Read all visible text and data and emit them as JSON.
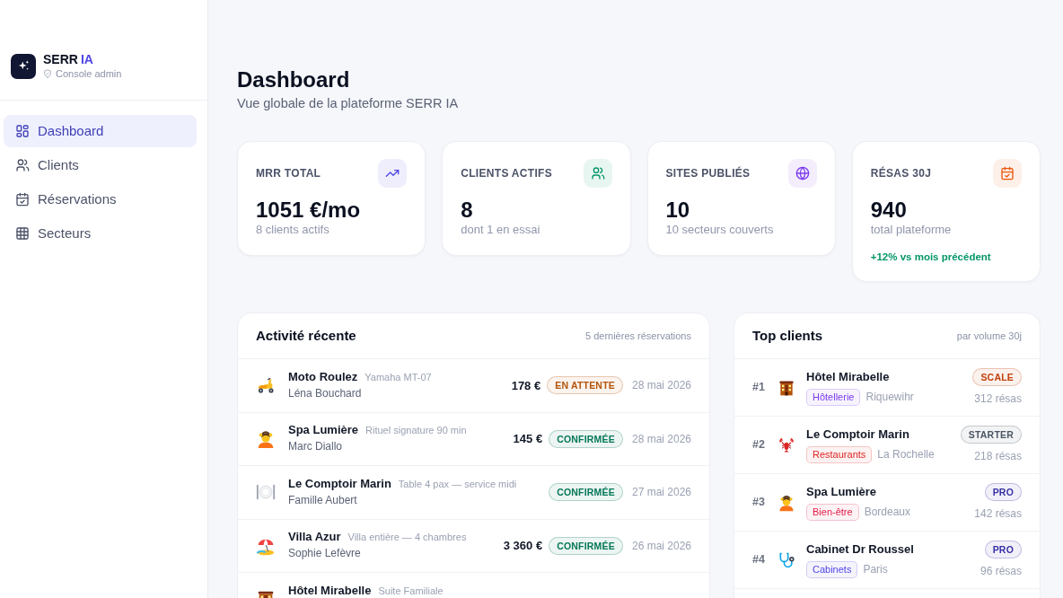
{
  "sidebar": {
    "brand": {
      "name": "SERR",
      "accent": "IA",
      "subtitle": "Console admin"
    },
    "items": [
      {
        "label": "Dashboard",
        "selected": true
      },
      {
        "label": "Clients",
        "selected": false
      },
      {
        "label": "Réservations",
        "selected": false
      },
      {
        "label": "Secteurs",
        "selected": false
      }
    ]
  },
  "header": {
    "title": "Dashboard",
    "subtitle": "Vue globale de la plateforme SERR IA"
  },
  "stats": [
    {
      "label": "MRR TOTAL",
      "value": "1051 €/mo",
      "note": "8 clients actifs",
      "color": "#4f46e5"
    },
    {
      "label": "CLIENTS ACTIFS",
      "value": "8",
      "note": "dont 1 en essai",
      "color": "#059669"
    },
    {
      "label": "SITES PUBLIÉS",
      "value": "10",
      "note": "10 secteurs couverts",
      "color": "#7c3aed"
    },
    {
      "label": "RÉSAS 30J",
      "value": "940",
      "note": "total plateforme",
      "trend": "+12% vs mois précédent",
      "color": "#ea580c"
    }
  ],
  "activity": {
    "title": "Activité récente",
    "caption": "5 dernières réservations",
    "rows": [
      {
        "business": "Moto Roulez",
        "detail": "Yamaha MT-07",
        "customer": "Léna Bouchard",
        "amount": "178 €",
        "status": {
          "label": "EN ATTENTE",
          "color": "#b45309"
        },
        "date": "28 mai 2026"
      },
      {
        "business": "Spa Lumière",
        "detail": "Rituel signature 90 min",
        "customer": "Marc Diallo",
        "amount": "145 €",
        "status": {
          "label": "CONFIRMÉE",
          "color": "#047857"
        },
        "date": "28 mai 2026"
      },
      {
        "business": "Le Comptoir Marin",
        "detail": "Table 4 pax — service midi",
        "customer": "Famille Aubert",
        "status": {
          "label": "CONFIRMÉE",
          "color": "#047857"
        },
        "date": "27 mai 2026"
      },
      {
        "business": "Villa Azur",
        "detail": "Villa entière — 4 chambres",
        "customer": "Sophie Lefèvre",
        "amount": "3 360 €",
        "status": {
          "label": "CONFIRMÉE",
          "color": "#047857"
        },
        "date": "26 mai 2026"
      },
      {
        "business": "Hôtel Mirabelle",
        "detail": "Suite Familiale"
      }
    ]
  },
  "top_clients": {
    "title": "Top clients",
    "caption": "par volume 30j",
    "rows": [
      {
        "rank": "#1",
        "name": "Hôtel Mirabelle",
        "sector": {
          "label": "Hôtellerie",
          "color": "#7c3aed"
        },
        "city": "Riquewihr",
        "plan": {
          "label": "SCALE",
          "color": "#c2410c"
        },
        "volume": "312 résas"
      },
      {
        "rank": "#2",
        "name": "Le Comptoir Marin",
        "sector": {
          "label": "Restaurants",
          "color": "#dc2626"
        },
        "city": "La Rochelle",
        "plan": {
          "label": "STARTER",
          "color": "#4b5563"
        },
        "volume": "218 résas"
      },
      {
        "rank": "#3",
        "name": "Spa Lumière",
        "sector": {
          "label": "Bien-être",
          "color": "#e11d48"
        },
        "city": "Bordeaux",
        "plan": {
          "label": "PRO",
          "color": "#3730a3"
        },
        "volume": "142 résas"
      },
      {
        "rank": "#4",
        "name": "Cabinet Dr Roussel",
        "sector": {
          "label": "Cabinets",
          "color": "#4f46e5"
        },
        "city": "Paris",
        "plan": {
          "label": "PRO",
          "color": "#3730a3"
        },
        "volume": "96 résas"
      }
    ]
  }
}
